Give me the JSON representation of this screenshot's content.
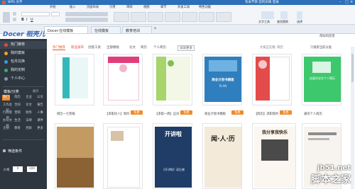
{
  "titlebar": {
    "app": "WPS 文字",
    "right_text": "有关节目 您的剑来 登录"
  },
  "ribbon": {
    "menus": [
      "开始",
      "插入",
      "页面布局",
      "引用",
      "审阅",
      "视图",
      "章节",
      "开发工具",
      "特色功能"
    ],
    "right": [
      "文字工具",
      "查找替换",
      "选择"
    ]
  },
  "tabs": [
    {
      "label": "Docer-在线模板"
    },
    {
      "label": "在线模板"
    },
    {
      "label": "教育培训"
    }
  ],
  "header": {
    "brand": "Docer 稻壳儿",
    "feedback": "帮助和反馈"
  },
  "sidebar": {
    "items": [
      {
        "label": "热门推荐",
        "color": "#e8483e"
      },
      {
        "label": "我的模板",
        "color": "#f0a32b"
      },
      {
        "label": "包月兑换",
        "color": "#3d9be0"
      },
      {
        "label": "我的定制",
        "color": "#35b06a"
      },
      {
        "label": "个人中心",
        "color": "#8a96a6"
      }
    ],
    "section_title": "模板/分类",
    "section_toggle": "展开",
    "categories": [
      [
        "热门",
        "简历",
        "企业",
        "公文"
      ],
      [
        "工作总结",
        "合同",
        "论文",
        "报告"
      ],
      [
        "行政管理",
        "营销",
        "财务",
        "人事"
      ],
      [
        "办公文档",
        "生活",
        "法律",
        "课件"
      ],
      [
        "企划",
        "教育",
        "党政",
        "更多"
      ]
    ],
    "filter_title": "筛选条件",
    "filter_price": "价格",
    "filter_from": "0",
    "filter_to": "100"
  },
  "subtabs": [
    "热门推荐",
    "新品发布",
    "创意工具",
    "全部模板",
    "论文",
    "简历",
    "个人简历",
    "试试更多"
  ],
  "search": {
    "placeholder": "大家正在搜: 简历",
    "scope": "只搜索当前分类"
  },
  "cards_row1": [
    {
      "caption": "简历一七卷级",
      "badge": ""
    },
    {
      "caption": "【求职达人】简约",
      "badge": "免费"
    },
    {
      "caption": "【求职一周】应对",
      "badge": "免费"
    },
    {
      "caption": "商业计划书模板",
      "badge": "免费"
    },
    {
      "caption": "【简历】求职简约",
      "badge": "免费"
    },
    {
      "caption": "通讯个人简历",
      "badge": ""
    }
  ],
  "card_texts": {
    "plan_title": "商业计划书模板",
    "plan_sub": "PLAN",
    "green_title": "应届毕业生个人简历",
    "book_title": "开讲啦",
    "book_sub": "《开讲啦》读后感",
    "char_title": "闻·人·历",
    "banner_title": "我分享我快乐"
  },
  "watermark": {
    "url": "jb51.net",
    "name": "脚本之家"
  },
  "colors": {
    "sidebar": "#2e3640",
    "accent": "#f08a2a",
    "titlebar": "#2d6fb8"
  }
}
